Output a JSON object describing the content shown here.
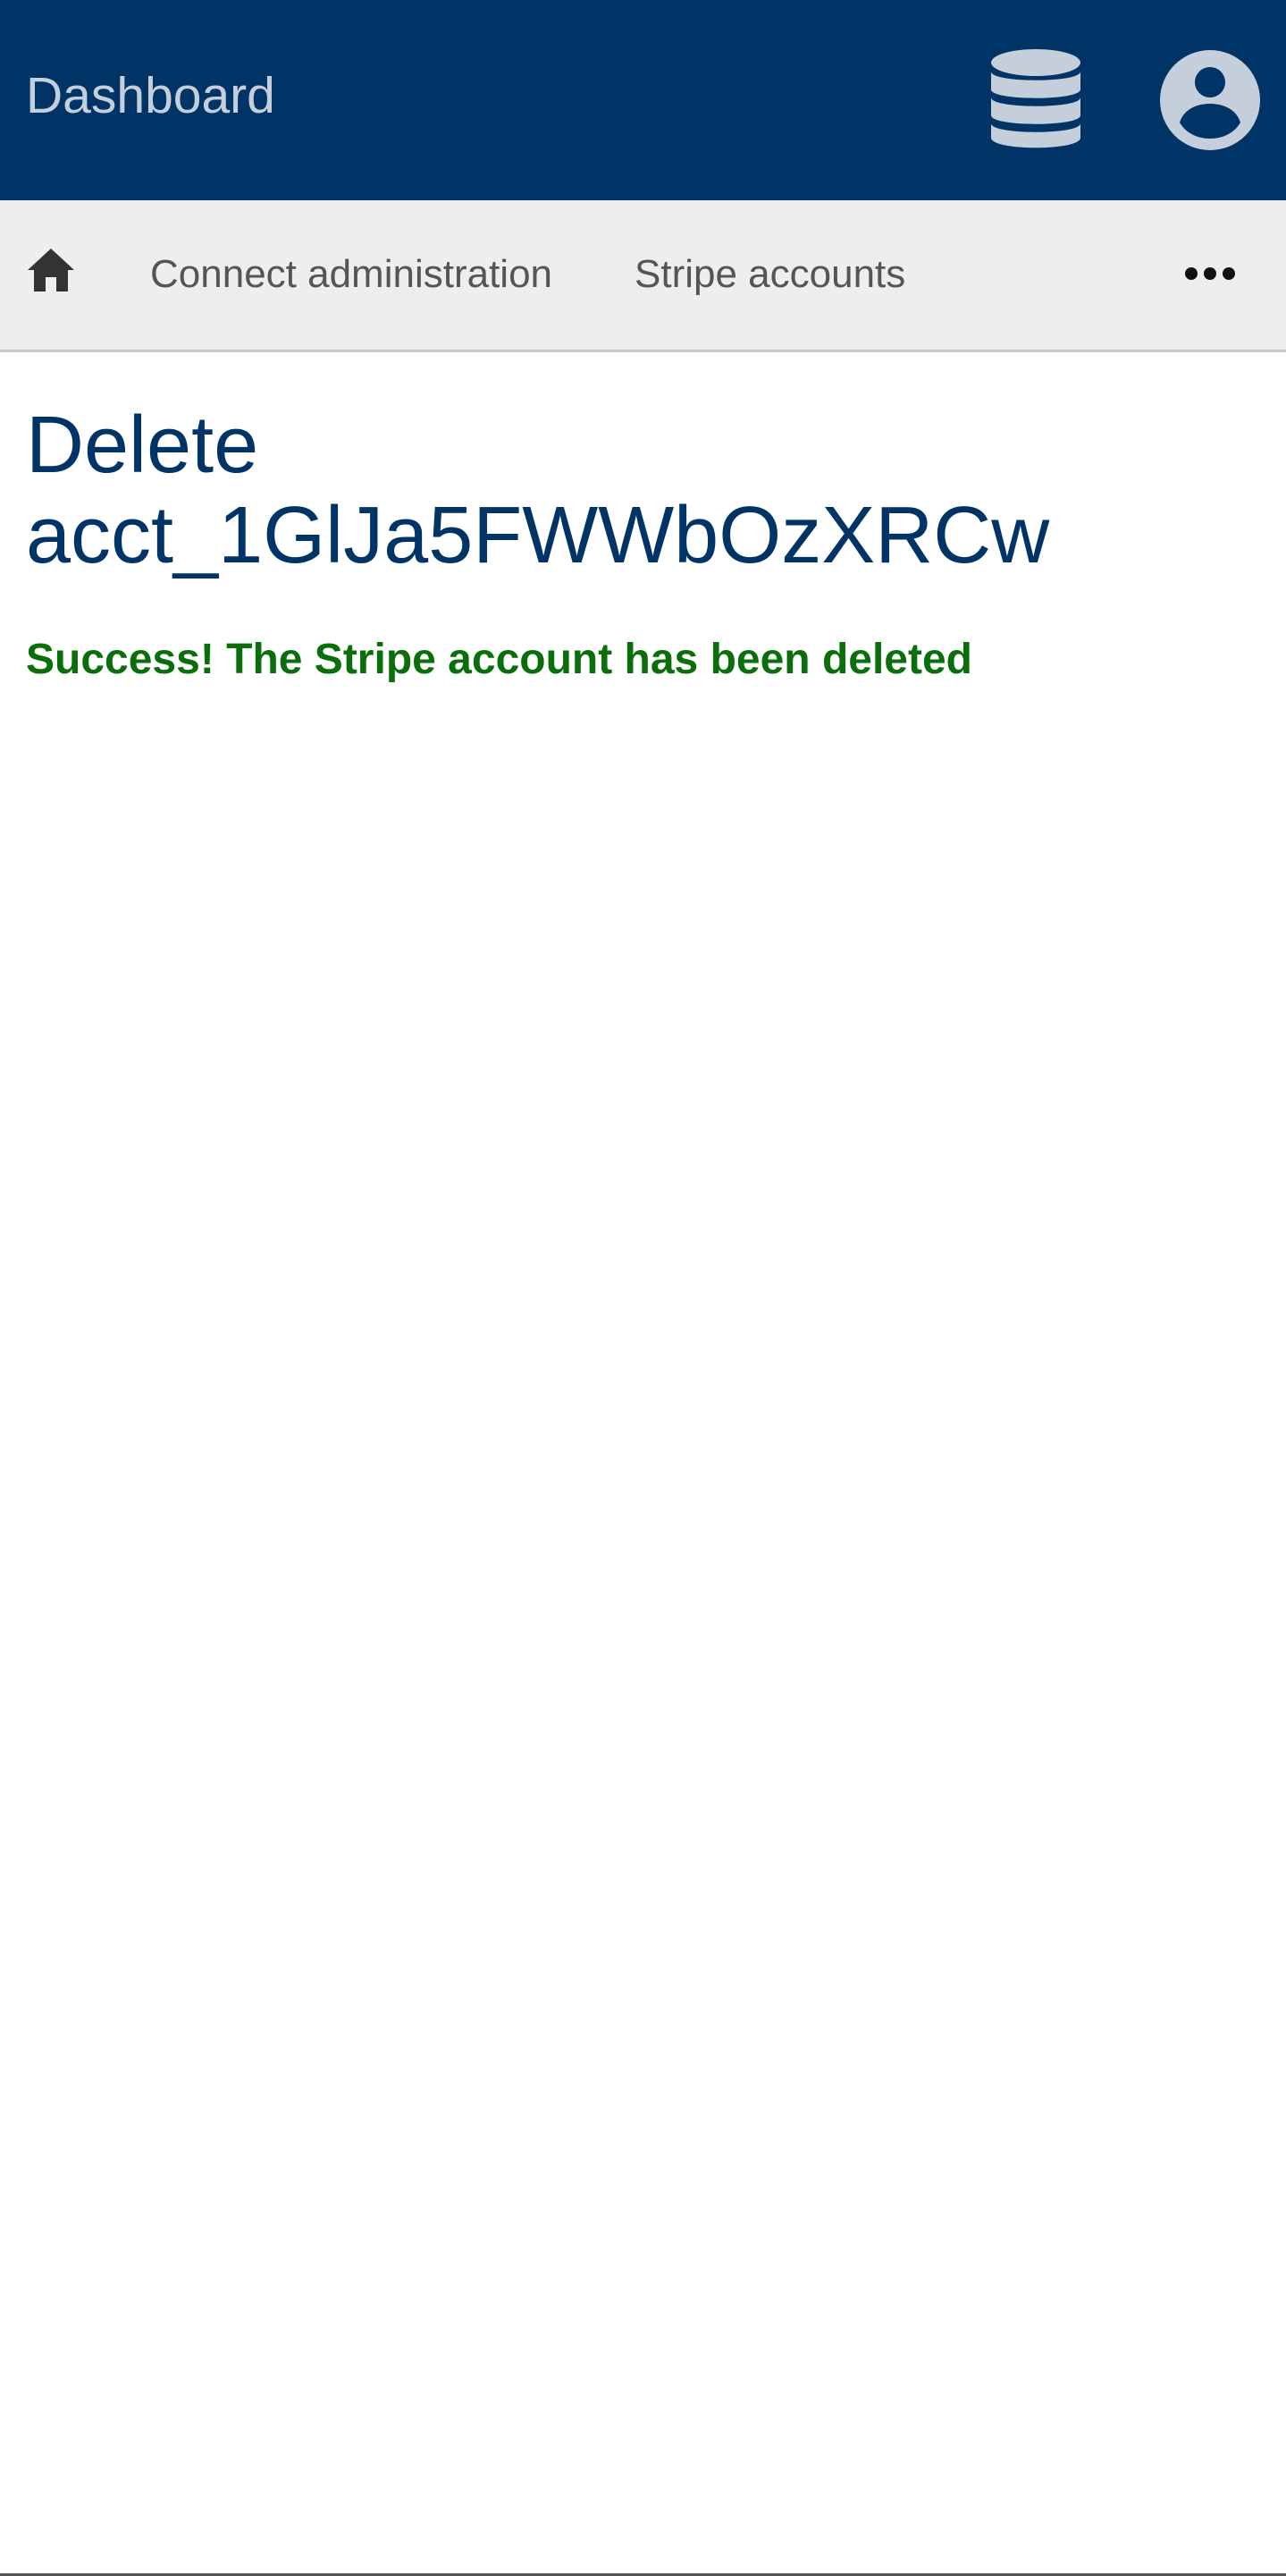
{
  "header": {
    "brand": "Dashboard",
    "background_color": "#003366",
    "icons": {
      "database": "database-icon",
      "account": "account-circle-icon"
    }
  },
  "nav": {
    "home_icon": "home-icon",
    "links": [
      {
        "label": "Connect administration"
      },
      {
        "label": "Stripe accounts"
      }
    ],
    "more_icon": "more-horizontal-icon"
  },
  "main": {
    "title_line1": "Delete",
    "title_line2": "acct_1GlJa5FWWbOzXRCw",
    "success_message": "Success! The Stripe account has been deleted",
    "success_color": "#0a6e0a",
    "title_color": "#003366"
  }
}
